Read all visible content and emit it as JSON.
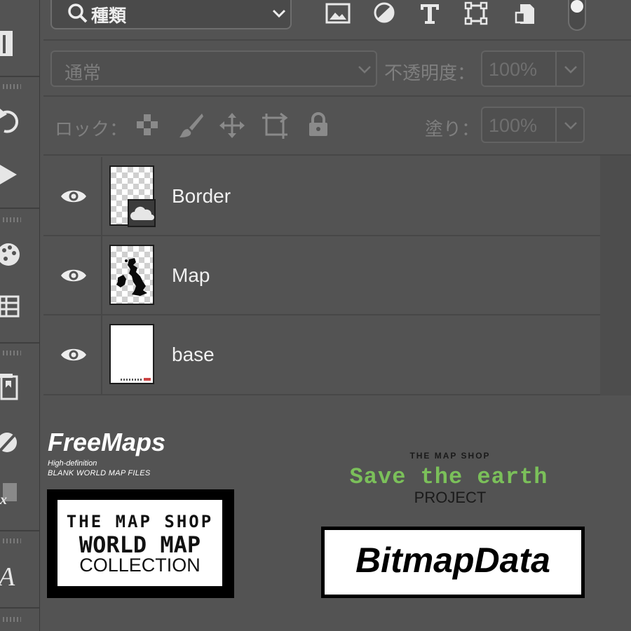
{
  "filter_bar": {
    "search_label": "種類",
    "filter_icons": [
      "image-filter-icon",
      "adjustment-filter-icon",
      "type-filter-icon",
      "shape-filter-icon",
      "smart-object-filter-icon"
    ]
  },
  "blend_row": {
    "mode": "通常",
    "opacity_label": "不透明度：",
    "opacity_value": "100%"
  },
  "lock_row": {
    "lock_label": "ロック：",
    "fill_label": "塗り：",
    "fill_value": "100%"
  },
  "layers": [
    {
      "name": "Border",
      "thumbnail": "transparent-smart-object"
    },
    {
      "name": "Map",
      "thumbnail": "british-isles-silhouette"
    },
    {
      "name": "base",
      "thumbnail": "white-page"
    }
  ],
  "branding": {
    "freemaps_title": "FreeMaps",
    "freemaps_sub1": "High-definition",
    "freemaps_sub2": "BLANK WORLD MAP FILES",
    "shop_line1": "THE MAP SHOP",
    "shop_line2": "WORLD MAP",
    "shop_line3": "COLLECTION",
    "save_small": "THE MAP SHOP",
    "save_title": "Save the earth",
    "save_project": "PROJECT",
    "bitmap": "BitmapData",
    "save_color": "#7bc05a"
  }
}
